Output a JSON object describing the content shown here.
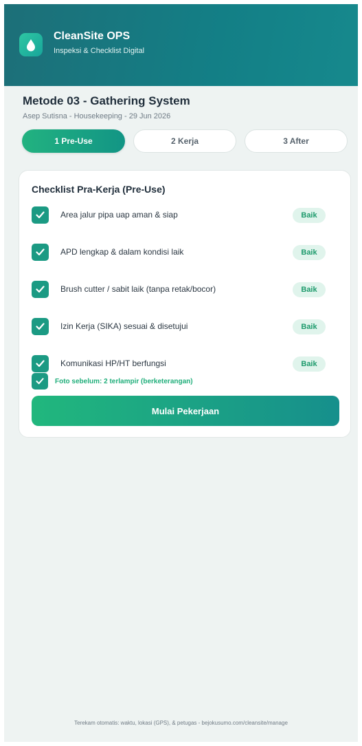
{
  "header": {
    "app_name": "CleanSite OPS",
    "subtitle": "Inspeksi & Checklist Digital",
    "logo_icon": "water-drop-icon",
    "gradient_start": "#1d6f78",
    "gradient_end": "#16898d"
  },
  "page": {
    "title": "Metode 03 - Gathering System",
    "meta": "Asep Sutisna - Housekeeping - 29 Jun 2026"
  },
  "steps": [
    {
      "label": "1 Pre-Use",
      "active": true
    },
    {
      "label": "2 Kerja",
      "active": false
    },
    {
      "label": "3 After",
      "active": false
    }
  ],
  "checklist": {
    "title": "Checklist Pra-Kerja (Pre-Use)",
    "items": [
      {
        "label": "Area jalur pipa uap aman & siap",
        "status": "Baik",
        "checked": true
      },
      {
        "label": "APD lengkap & dalam kondisi laik",
        "status": "Baik",
        "checked": true
      },
      {
        "label": "Brush cutter / sabit laik (tanpa retak/bocor)",
        "status": "Baik",
        "checked": true
      },
      {
        "label": "Izin Kerja (SIKA) sesuai & disetujui",
        "status": "Baik",
        "checked": true
      },
      {
        "label": "Komunikasi HP/HT berfungsi",
        "status": "Baik",
        "checked": true
      }
    ],
    "photo_note": "Foto sebelum: 2 terlampir (berketerangan)",
    "action_label": "Mulai Pekerjaan"
  },
  "colors": {
    "accent": "#1b9a83",
    "badge_bg": "#e0f4ec",
    "badge_text": "#1d9a6c",
    "background": "#eef3f2"
  },
  "footer": {
    "text": "Terekam otomatis: waktu, lokasi (GPS), & petugas - bejokusumo.com/cleansite/manage"
  }
}
